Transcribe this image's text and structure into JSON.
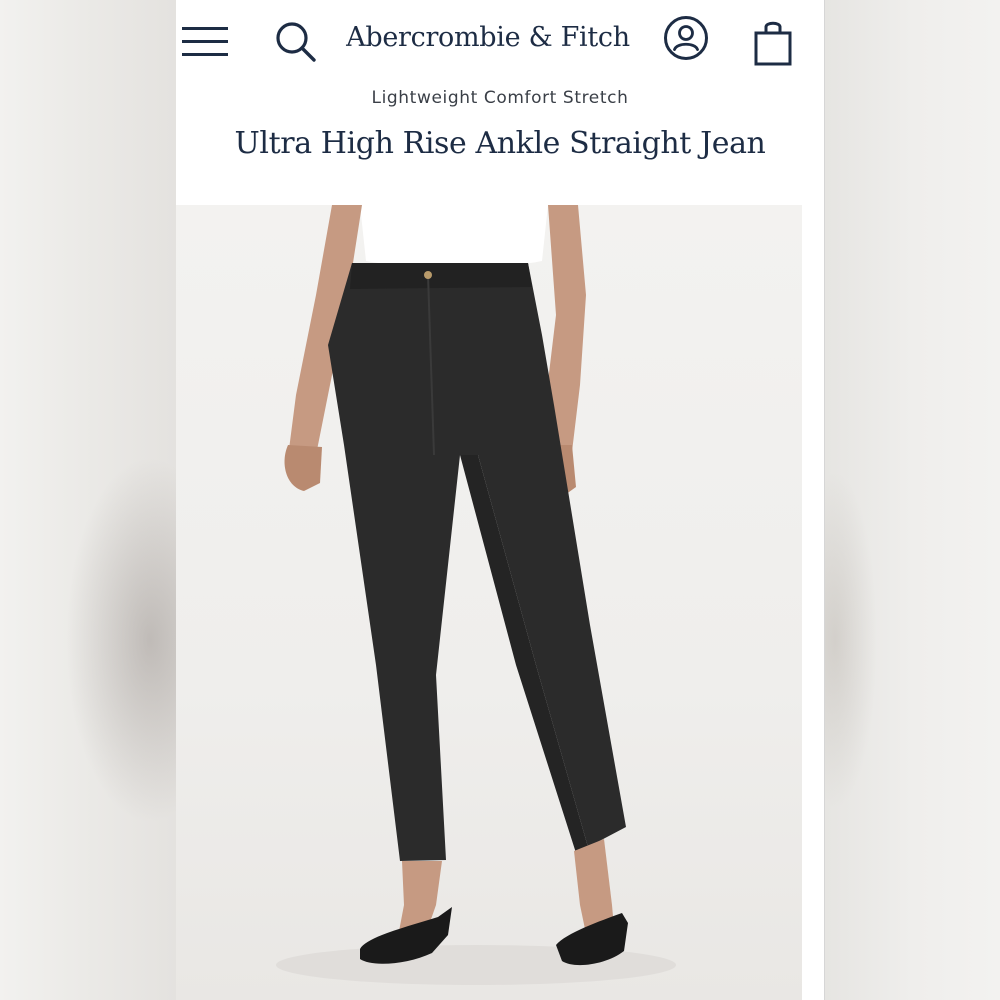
{
  "header": {
    "brand": "Abercrombie & Fitch",
    "icons": {
      "menu": "hamburger-menu-icon",
      "search": "search-icon",
      "account": "account-icon",
      "bag": "shopping-bag-icon"
    },
    "brand_color": "#1d2c44"
  },
  "product": {
    "subtitle": "Lightweight Comfort Stretch",
    "name": "Ultra High Rise Ankle Straight Jean",
    "image": {
      "subject": "model wearing black jeans, white top, black strappy sandals",
      "jean_color": "#2a2a2a"
    }
  }
}
